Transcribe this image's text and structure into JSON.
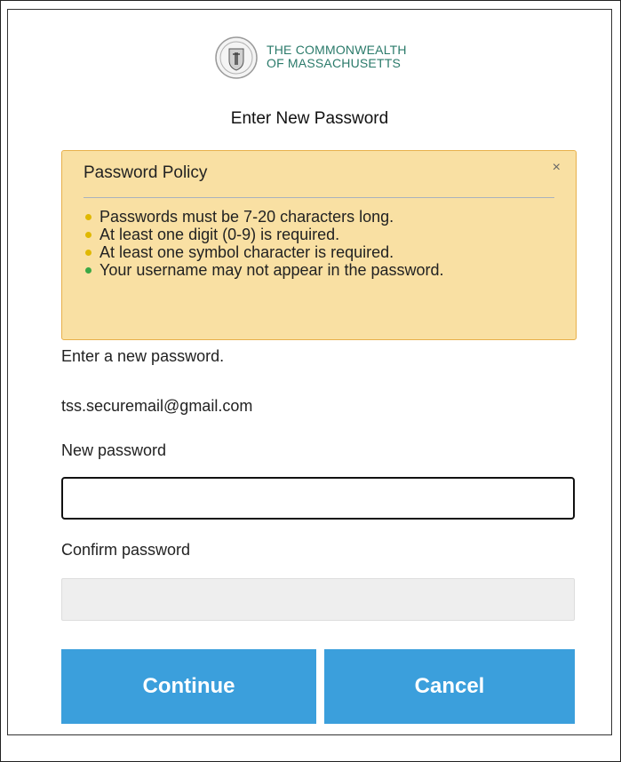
{
  "header": {
    "org_line1": "THE COMMONWEALTH",
    "org_line2": "OF MASSACHUSETTS",
    "seal_icon": "massachusetts-seal-icon"
  },
  "title": "Enter New Password",
  "policy": {
    "heading": "Password Policy",
    "close_label": "×",
    "rules": [
      {
        "text": "Passwords must be 7-20 characters long.",
        "status": "warning"
      },
      {
        "text": "At least one digit (0-9) is required.",
        "status": "warning"
      },
      {
        "text": "At least one symbol character is required.",
        "status": "warning"
      },
      {
        "text": "Your username may not appear in the password.",
        "status": "ok"
      }
    ]
  },
  "form": {
    "instruction": "Enter a new password.",
    "username": "tss.securemail@gmail.com",
    "new_password_label": "New password",
    "new_password_value": "",
    "confirm_password_label": "Confirm password",
    "confirm_password_value": ""
  },
  "buttons": {
    "continue": "Continue",
    "cancel": "Cancel"
  },
  "colors": {
    "accent": "#3b9fdc",
    "policy_bg": "#f9e0a3",
    "policy_border": "#e8b04a",
    "warning": "#e0b800",
    "ok": "#3aa845",
    "org_text": "#2a7a6a"
  }
}
